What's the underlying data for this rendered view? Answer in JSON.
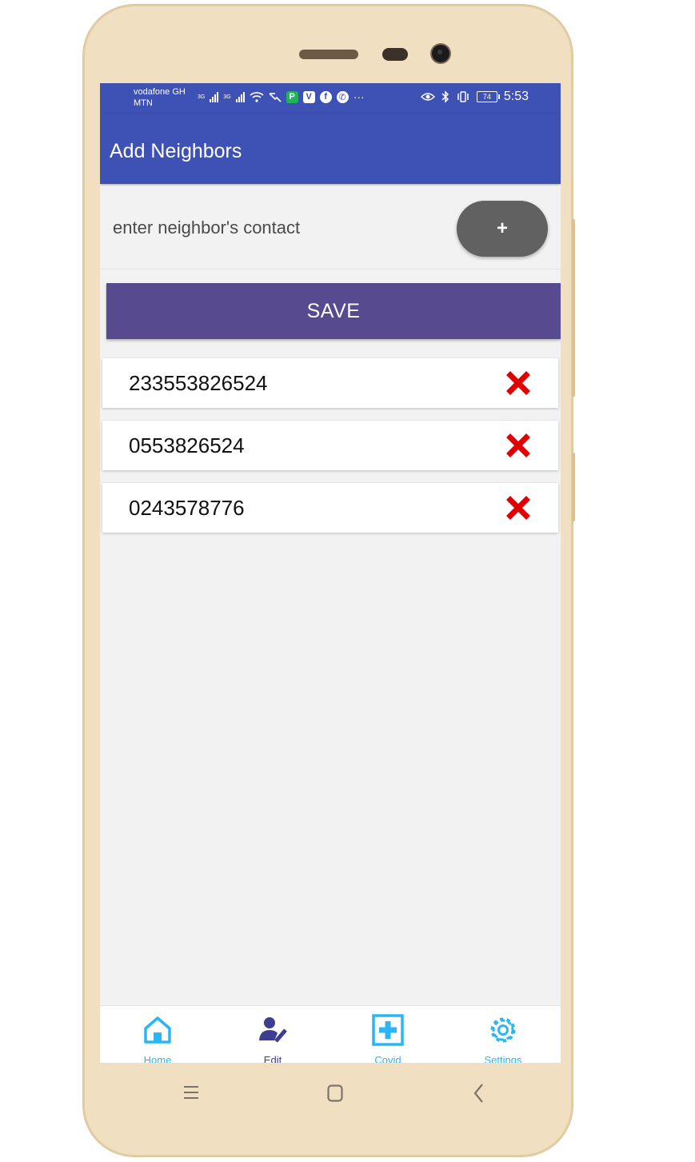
{
  "status_bar": {
    "carrier_line1": "vodafone GH",
    "carrier_line2": "MTN",
    "network1": "3G",
    "network2": "3G",
    "battery_level": "74",
    "time": "5:53",
    "overflow": "···"
  },
  "app_bar": {
    "title": "Add Neighbors"
  },
  "contact_input": {
    "placeholder": "enter neighbor's contact",
    "value": ""
  },
  "add_button": {
    "label": "+"
  },
  "save_button": {
    "label": "SAVE"
  },
  "neighbors": [
    {
      "number": "233553826524"
    },
    {
      "number": "0553826524"
    },
    {
      "number": "0243578776"
    }
  ],
  "bottom_nav": {
    "items": [
      {
        "label": "Home",
        "icon": "home-icon",
        "color": "#29b6f6"
      },
      {
        "label": "Edit",
        "icon": "edit-user-icon",
        "color": "#3e3e8f"
      },
      {
        "label": "Covid",
        "icon": "medical-cross-icon",
        "color": "#29b6f6"
      },
      {
        "label": "Settings",
        "icon": "gear-icon",
        "color": "#29b6f6"
      }
    ]
  },
  "colors": {
    "primary": "#3e51b5",
    "save_button": "#584a8f",
    "add_button": "#616161",
    "delete": "#e00000",
    "accent": "#29b6f6"
  }
}
